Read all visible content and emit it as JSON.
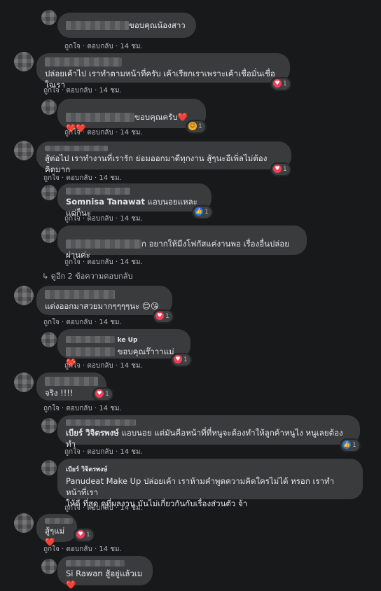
{
  "actions": {
    "like": "ถูกใจ",
    "reply": "ตอบกลับ",
    "sep": " · "
  },
  "icons": {
    "heart": "heart-icon",
    "like": "like-icon",
    "care": "care-icon",
    "reply_arrow": "reply-arrow-icon"
  },
  "colors": {
    "bubble": "#3a3b3c",
    "background": "#18191a",
    "heart": "#f33e58",
    "like": "#2078f4"
  },
  "view_more_replies": "ดูอีก 2 ข้อความตอบกลับ",
  "comments": [
    {
      "text": "ขอบคุณน้องสาว",
      "time": "14 ชม.",
      "reaction_count": ""
    },
    {
      "text": "ปล่อยเค้าไป เราทำตามหน้าที่ครับ เค้าเรียกเราเพราะเค้าเชื่อมั่นเชื่อใจเรา",
      "time": "14 ชม.",
      "reaction_count": "1"
    },
    {
      "text": "ขอบคุณครับ❤️❤️❤️",
      "time": "14 ชม.",
      "reaction_count": "1"
    },
    {
      "text": "สู้ต่อไป เราทำงานที่เรารัก ย่อมออกมาดีทุกงาน สู้ๆนะอีเพิ่ลไม่ต้องคิดมาก",
      "time": "14 ชม.",
      "reaction_count": "1"
    },
    {
      "name": "Somnisa Tanawat",
      "text": "แอบนอยแหละ แต่ก็นะ",
      "time": "14 ชม.",
      "reaction_count": "1"
    },
    {
      "text": "ก อยากให้มีงโฟกัสแค่งานพอ เรื่องอื่นปล่อยผ่านค่ะ",
      "time": "14 ชม.",
      "reaction_count": ""
    },
    {
      "text": "แต่งออกมาสวยมากๆๆๆๆนะ 😊😘",
      "time": "14 ชม.",
      "reaction_count": "1"
    },
    {
      "name_suffix": "ke Up",
      "text": "ขอบคุณร๊าาาแม่❤️",
      "time": "14 ชม.",
      "reaction_count": "1"
    },
    {
      "text": "จริง !!!!",
      "time": "14 ชม.",
      "reaction_count": "1"
    },
    {
      "name": "เบียร์ วิจิตรพงษ์",
      "text": "แอบนอย แต่มันคือหน้าที่ที่หนูจะต้องทำให้ลูกค้าหนูไง หนูเลยต้องทำ",
      "time": "14 ชม.",
      "reaction_count": "1"
    },
    {
      "name": "เบียร์ วิจิตรพงษ์",
      "name2": "Panudeat Make Up",
      "text1": "ปล่อยเค้า เราห้ามคำพูดความคิดใครไม่ได้ หรอก เราทำหน้าที่เรา",
      "text2": "ให้ดี ที่สุด ดูที่ผลงาน มันไม่เกี่ยวกันกับเรื่องส่วนตัว จ้า",
      "time": "14 ชม.",
      "reaction_count": ""
    },
    {
      "text": "สู้ๆแม่❤️",
      "time": "14 ชม.",
      "reaction_count": "1"
    },
    {
      "name": "Si Rawan",
      "text": "สู้อยู่แล้วเม❤️",
      "time": "",
      "reaction_count": ""
    }
  ]
}
